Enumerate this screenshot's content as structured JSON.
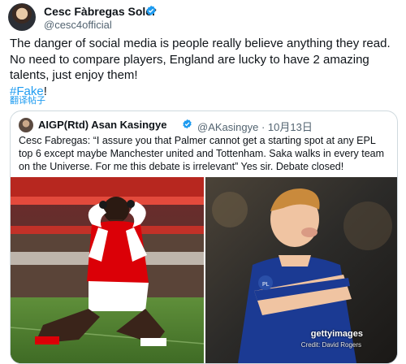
{
  "author": {
    "name": "Cesc Fàbregas Soler",
    "handle": "@cesc4official"
  },
  "tweet": {
    "line1": "The danger of social media is people really believe anything they read.",
    "line2": "No need to compare players, England are lucky to have 2 amazing",
    "line3": "talents, just enjoy them!",
    "hashtag": "#Fake",
    "hashtag_suffix": "!",
    "translate_label": "翻译帖子"
  },
  "quote": {
    "name": "AIGP(Rtd) Asan Kasingye",
    "handle_date": "@AKasingye · 10月13日",
    "text": "Cesc Fabregas: “I assure you that Palmer cannot get a starting spot at any EPL top 6 except maybe Manchester united and Tottenham. Saka walks in every team on the Universe. For me this debate is irrelevant” Yes sir. Debate closed!"
  },
  "media": {
    "watermark": "gettyimages",
    "credit": "Credit: David Rogers"
  },
  "colors": {
    "accent": "#1d9bf0",
    "arsenal_red": "#db0007",
    "chelsea_blue": "#1b3a93"
  },
  "icons": [
    "verified-badge-icon"
  ]
}
